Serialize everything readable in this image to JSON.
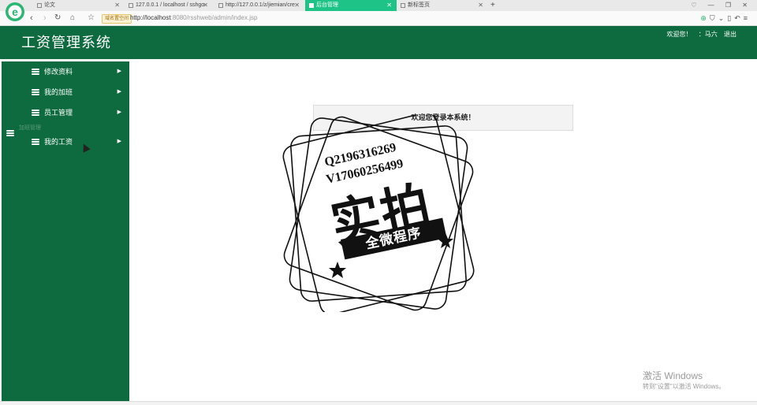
{
  "browser": {
    "tabs": [
      {
        "label": "论文",
        "active": false
      },
      {
        "label": "127.0.0.1 / localhost / sshgo",
        "active": false
      },
      {
        "label": "http://127.0.0.1/z/jiemian/cre",
        "active": false
      },
      {
        "label": "后台管理",
        "active": true
      },
      {
        "label": "新标签页",
        "active": false
      }
    ],
    "new_tab_label": "+",
    "secure_badge": "域名置空间",
    "url_host": "http://localhost",
    "url_rest": ":8080/rsshweb/admin/index.jsp"
  },
  "header": {
    "title": "工资管理系统",
    "welcome": "欢迎您！",
    "user_sep": "：",
    "username": "马六",
    "logout": "退出"
  },
  "sidebar": {
    "items": [
      {
        "label": "修改资料",
        "arrow": "▶"
      },
      {
        "label": "我的加班",
        "arrow": "▶"
      },
      {
        "label": "员工管理",
        "arrow": "▶"
      },
      {
        "label": "我的工资",
        "arrow": "▶"
      }
    ],
    "sub_label": "加班管理"
  },
  "main": {
    "welcome_message": "欢迎您登录本系统！"
  },
  "stamp": {
    "qq": "Q2196316269",
    "vx": "V17060256499",
    "big": "实拍",
    "ribbon": "全微程序"
  },
  "windows_watermark": {
    "line1": "激活 Windows",
    "line2": "转到\"设置\"以激活 Windows。"
  },
  "colors": {
    "primary_green": "#0e6b3f",
    "active_tab": "#1ec387"
  }
}
